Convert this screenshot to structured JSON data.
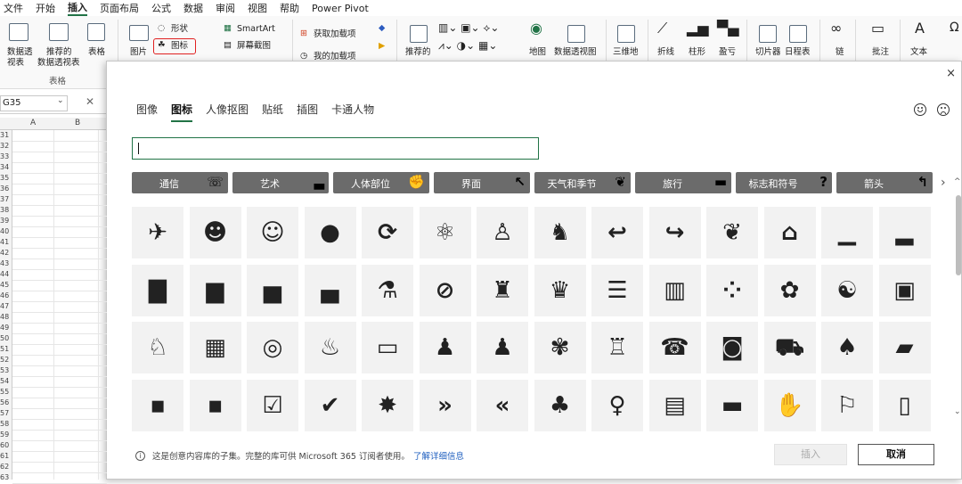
{
  "menu": [
    "文件",
    "开始",
    "插入",
    "页面布局",
    "公式",
    "数据",
    "审阅",
    "视图",
    "帮助",
    "Power Pivot"
  ],
  "menu_active_index": 2,
  "ribbon": {
    "pivot_table": "数据透\n视表",
    "pivot_table_1": "数据透",
    "pivot_table_2": "视表",
    "recommended_pivot_1": "推荐的",
    "recommended_pivot_2": "数据透视表",
    "table": "表格",
    "tables_group": "表格",
    "picture": "图片",
    "shapes": "形状",
    "icons": "图标",
    "smartart": "SmartArt",
    "screenshot": "屏幕截图",
    "get_addins": "获取加载项",
    "my_addins": "我的加载项",
    "recommended_charts": "推荐的",
    "map": "地图",
    "pivot_chart": "数据透视图",
    "three_d_map": "三维地",
    "line": "折线",
    "column": "柱形",
    "winloss": "盈亏",
    "slicer": "切片器",
    "timeline": "日程表",
    "link": "链",
    "comment": "批注",
    "text": "文本"
  },
  "namebox": "G35",
  "columns": [
    "A",
    "B"
  ],
  "rows": [
    "31",
    "32",
    "33",
    "34",
    "35",
    "36",
    "37",
    "38",
    "39",
    "40",
    "41",
    "42",
    "43",
    "44",
    "45",
    "46",
    "47",
    "48",
    "49",
    "50",
    "51",
    "52",
    "53",
    "54",
    "55",
    "56",
    "57",
    "58",
    "59",
    "60",
    "61",
    "62",
    "63"
  ],
  "dialog": {
    "tabs": [
      "图像",
      "图标",
      "人像抠图",
      "贴纸",
      "插图",
      "卡通人物"
    ],
    "active_tab": 1,
    "search_value": "",
    "categories": [
      {
        "label": "通信",
        "icon": "phone-icon",
        "glyph": "☏"
      },
      {
        "label": "艺术",
        "icon": "art-icon",
        "glyph": "▃"
      },
      {
        "label": "人体部位",
        "icon": "arm-icon",
        "glyph": "✊"
      },
      {
        "label": "界面",
        "icon": "cursor-icon",
        "glyph": "↖"
      },
      {
        "label": "天气和季节",
        "icon": "plant-icon",
        "glyph": "❦"
      },
      {
        "label": "旅行",
        "icon": "briefcase-icon",
        "glyph": "▬"
      },
      {
        "label": "标志和符号",
        "icon": "question-icon",
        "glyph": "?"
      },
      {
        "label": "箭头",
        "icon": "arrow-icon",
        "glyph": "↰"
      }
    ],
    "icons": [
      [
        "airplane-icon",
        "✈"
      ],
      [
        "smiley-halo-icon",
        "☻"
      ],
      [
        "smiley-halo-outline-icon",
        "☺"
      ],
      [
        "apple-icon",
        "●"
      ],
      [
        "refresh-icon",
        "⟳"
      ],
      [
        "atom-icon",
        "⚛"
      ],
      [
        "baby-icon",
        "♙"
      ],
      [
        "crawling-baby-icon",
        "♞"
      ],
      [
        "reply-arrow-icon",
        "↩"
      ],
      [
        "forward-arrow-icon",
        "↪"
      ],
      [
        "balloons-icon",
        "❦"
      ],
      [
        "bank-icon",
        "⌂"
      ],
      [
        "bar-chart-icon",
        "▁"
      ],
      [
        "bar-chart-rising-icon",
        "▂"
      ],
      [
        "bar-chart-falling-icon",
        "▇"
      ],
      [
        "bar-chart-trend-up-icon",
        "▆"
      ],
      [
        "bar-chart-trend-icon",
        "▅"
      ],
      [
        "bar-chart-down-icon",
        "▄"
      ],
      [
        "beaker-icon",
        "⚗"
      ],
      [
        "hidden-eye-icon",
        "⊘"
      ],
      [
        "meeting-icon",
        "♜"
      ],
      [
        "weightlifter-icon",
        "♛"
      ],
      [
        "books-icon",
        "☰"
      ],
      [
        "library-icon",
        "▥"
      ],
      [
        "braille-icon",
        "⁘"
      ],
      [
        "brain-icon",
        "✿"
      ],
      [
        "head-brain-icon",
        "☯"
      ],
      [
        "briefcase-icon",
        "▣"
      ],
      [
        "dinosaur-icon",
        "♘"
      ],
      [
        "building-icon",
        "▦"
      ],
      [
        "target-icon",
        "◎"
      ],
      [
        "fast-food-icon",
        "♨"
      ],
      [
        "bus-icon",
        "▭"
      ],
      [
        "group-rising-icon",
        "♟"
      ],
      [
        "group-falling-icon",
        "♟"
      ],
      [
        "butterfly-icon",
        "✾"
      ],
      [
        "birthday-cake-icon",
        "♖"
      ],
      [
        "call-center-icon",
        "☎"
      ],
      [
        "camera-icon",
        "◙"
      ],
      [
        "car-icon",
        "⛟"
      ],
      [
        "cat-icon",
        "♠"
      ],
      [
        "chat-bubbles-icon",
        "▰"
      ],
      [
        "chat-bubble-icon",
        "▪"
      ],
      [
        "chat-bubble-2-icon",
        "▪"
      ],
      [
        "checklist-icon",
        "☑"
      ],
      [
        "checkmark-icon",
        "✔"
      ],
      [
        "explosion-icon",
        "✸"
      ],
      [
        "chevrons-right-icon",
        "»"
      ],
      [
        "chevrons-left-icon",
        "«"
      ],
      [
        "crowd-icon",
        "♣"
      ],
      [
        "child-balloon-icon",
        "♀"
      ],
      [
        "city-icon",
        "▤"
      ],
      [
        "clapperboard-icon",
        "▬"
      ],
      [
        "clapping-hands-icon",
        "✋"
      ],
      [
        "classroom-icon",
        "⚐"
      ],
      [
        "clipboard-icon",
        "▯"
      ]
    ],
    "footer_note": "这是创意内容库的子集。完整的库可供 Microsoft 365 订阅者使用。",
    "more_link": "了解详细信息",
    "info_icon": "i",
    "insert_button": "插入",
    "cancel_button": "取消",
    "close_glyph": "×",
    "next_glyph": "›"
  }
}
